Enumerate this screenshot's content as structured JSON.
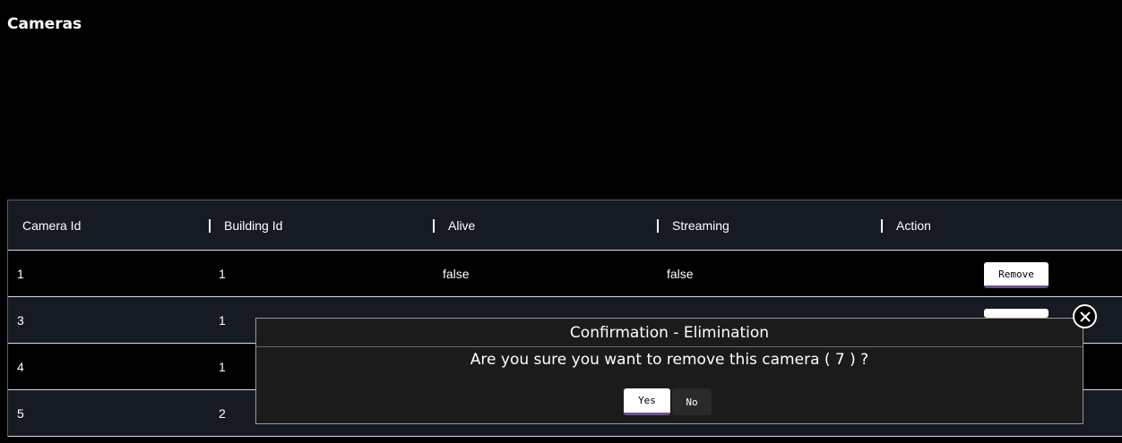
{
  "page": {
    "title": "Cameras"
  },
  "table": {
    "columns": [
      "Camera Id",
      "Building Id",
      "Alive",
      "Streaming",
      "Action"
    ],
    "rows": [
      {
        "camera_id": "1",
        "building_id": "1",
        "alive": "false",
        "streaming": "false",
        "action": "Remove"
      },
      {
        "camera_id": "3",
        "building_id": "1",
        "alive": "",
        "streaming": "",
        "action": ""
      },
      {
        "camera_id": "4",
        "building_id": "1",
        "alive": "",
        "streaming": "",
        "action": ""
      },
      {
        "camera_id": "5",
        "building_id": "2",
        "alive": "",
        "streaming": "",
        "action": ""
      }
    ]
  },
  "modal": {
    "title": "Confirmation - Elimination",
    "message": "Are you sure you want to remove this camera ( 7 ) ?",
    "yes_label": "Yes",
    "no_label": "No",
    "close_icon": "close-icon"
  },
  "colors": {
    "background": "#000000",
    "row_alt": "#161a22",
    "button_accent": "#6b4f9a"
  }
}
